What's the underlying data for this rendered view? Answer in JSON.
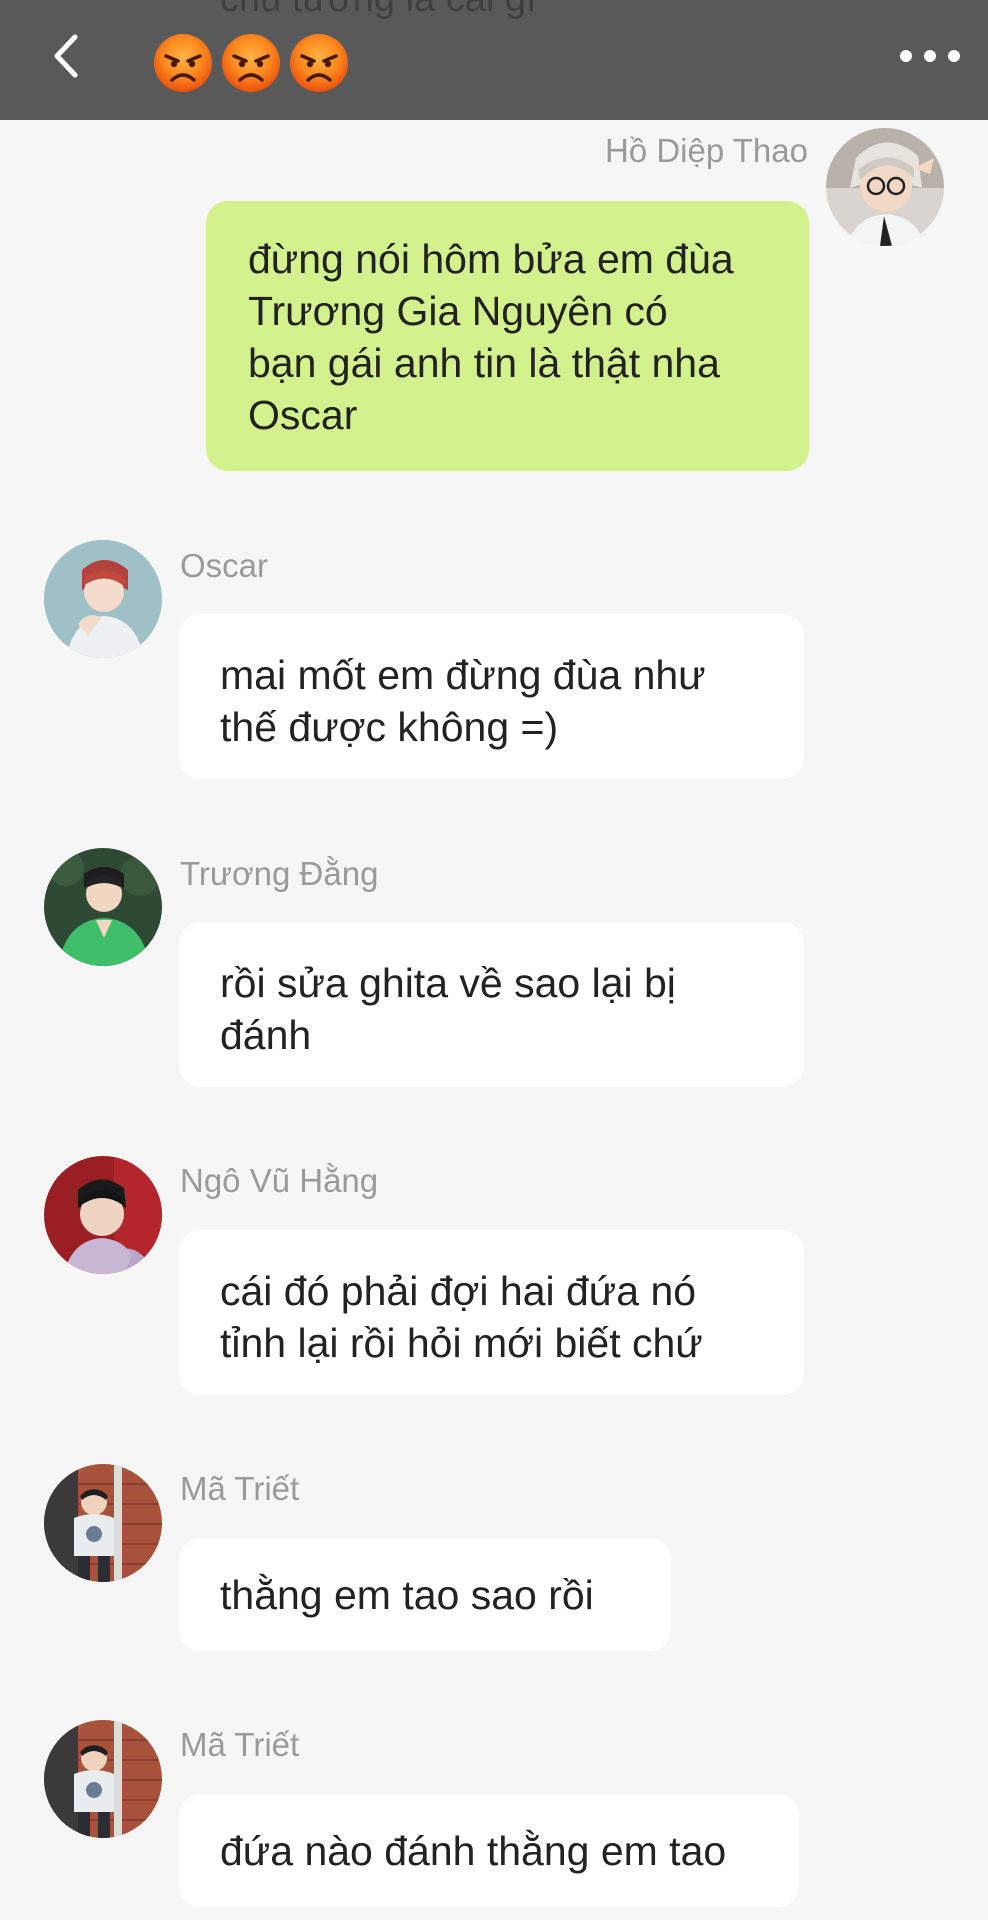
{
  "header": {
    "peek_text": "chủ tướng là cái gì",
    "title_icons": [
      "angry-face-icon",
      "angry-face-icon",
      "angry-face-icon"
    ],
    "back_icon": "chevron-left-icon",
    "more_icon": "more-dots-icon",
    "background": "#595959"
  },
  "colors": {
    "self_bubble": "#d3f28e",
    "other_bubble": "#ffffff",
    "sender_name": "#9a9a9a",
    "background": "#f6f6f6"
  },
  "messages": [
    {
      "sender": "Hồ Diệp Thao",
      "text": "đừng nói hôm bửa em đùa\nTrương Gia Nguyên có\nbạn gái anh tin là thật nha\nOscar",
      "self": true
    },
    {
      "sender": "Oscar",
      "text": "mai mốt em đừng đùa như\nthế được không =)",
      "self": false
    },
    {
      "sender": "Trương Đằng",
      "text": "rồi sửa ghita về sao lại bị\nđánh",
      "self": false
    },
    {
      "sender": "Ngô Vũ Hằng",
      "text": "cái đó phải đợi hai đứa nó\ntỉnh lại rồi hỏi mới biết chứ",
      "self": false
    },
    {
      "sender": "Mã Triết",
      "text": "thằng em tao sao rồi",
      "self": false
    },
    {
      "sender": "Mã Triết",
      "text": "đứa nào đánh thằng em tao",
      "self": false
    }
  ]
}
